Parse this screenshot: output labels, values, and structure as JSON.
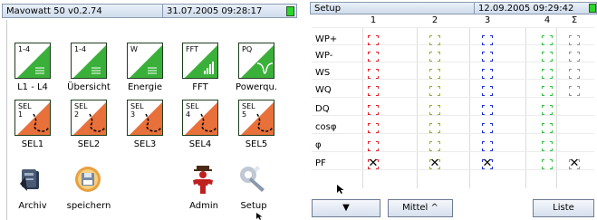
{
  "left_window": {
    "title": "Mavowatt 50 v0.2.74",
    "datetime": "31.07.2005 09:28:17",
    "tiles_row1": [
      {
        "code": "1-4",
        "label": "L1 - L4",
        "glyph": "lines-glyph"
      },
      {
        "code": "1-4",
        "label": "Übersicht",
        "glyph": "lines-glyph"
      },
      {
        "code": "W",
        "label": "Energie",
        "glyph": "lines-glyph"
      },
      {
        "code": "FFT",
        "label": "FFT",
        "glyph": "bars-glyph"
      },
      {
        "code": "PQ",
        "label": "Powerqu.",
        "glyph": "dip-glyph"
      }
    ],
    "tiles_row2": [
      {
        "code": "SEL\n1",
        "label": "SEL1"
      },
      {
        "code": "SEL\n2",
        "label": "SEL2"
      },
      {
        "code": "SEL\n3",
        "label": "SEL3"
      },
      {
        "code": "SEL\n4",
        "label": "SEL4"
      },
      {
        "code": "SEL\n5",
        "label": "SEL5"
      }
    ],
    "bottom_icons": [
      {
        "label": "Archiv",
        "icon": "archive-computer-icon"
      },
      {
        "label": "speichern",
        "icon": "save-disk-icon"
      },
      {
        "label": "Admin",
        "icon": "admin-person-icon"
      },
      {
        "label": "Setup",
        "icon": "setup-wrench-icon"
      }
    ]
  },
  "right_window": {
    "title": "Setup",
    "datetime": "12.09.2005 09:29:42",
    "columns": [
      "1",
      "2",
      "3",
      "4",
      "Σ"
    ],
    "column_colors": [
      "#e0202a",
      "#90b030",
      "#1a2ed0",
      "#30c040",
      "#909090"
    ],
    "rows": [
      "WP+",
      "WP-",
      "WS",
      "WQ",
      "DQ",
      "cosφ",
      "φ",
      "PF"
    ],
    "cells": [
      [
        "empty",
        "empty",
        "empty",
        "empty",
        "empty"
      ],
      [
        "empty",
        "empty",
        "empty",
        "empty",
        "empty"
      ],
      [
        "empty",
        "empty",
        "empty",
        "empty",
        "empty"
      ],
      [
        "empty",
        "empty",
        "empty",
        "empty",
        "empty"
      ],
      [
        "empty",
        "empty",
        "empty",
        "empty",
        "none"
      ],
      [
        "empty",
        "empty",
        "empty",
        "empty",
        "none"
      ],
      [
        "empty",
        "empty",
        "empty",
        "empty",
        "none"
      ],
      [
        "checked",
        "checked",
        "checked",
        "empty",
        "checked"
      ]
    ],
    "buttons": {
      "down_arrow": "▼",
      "mittel": "Mittel ^",
      "liste": "Liste"
    }
  }
}
